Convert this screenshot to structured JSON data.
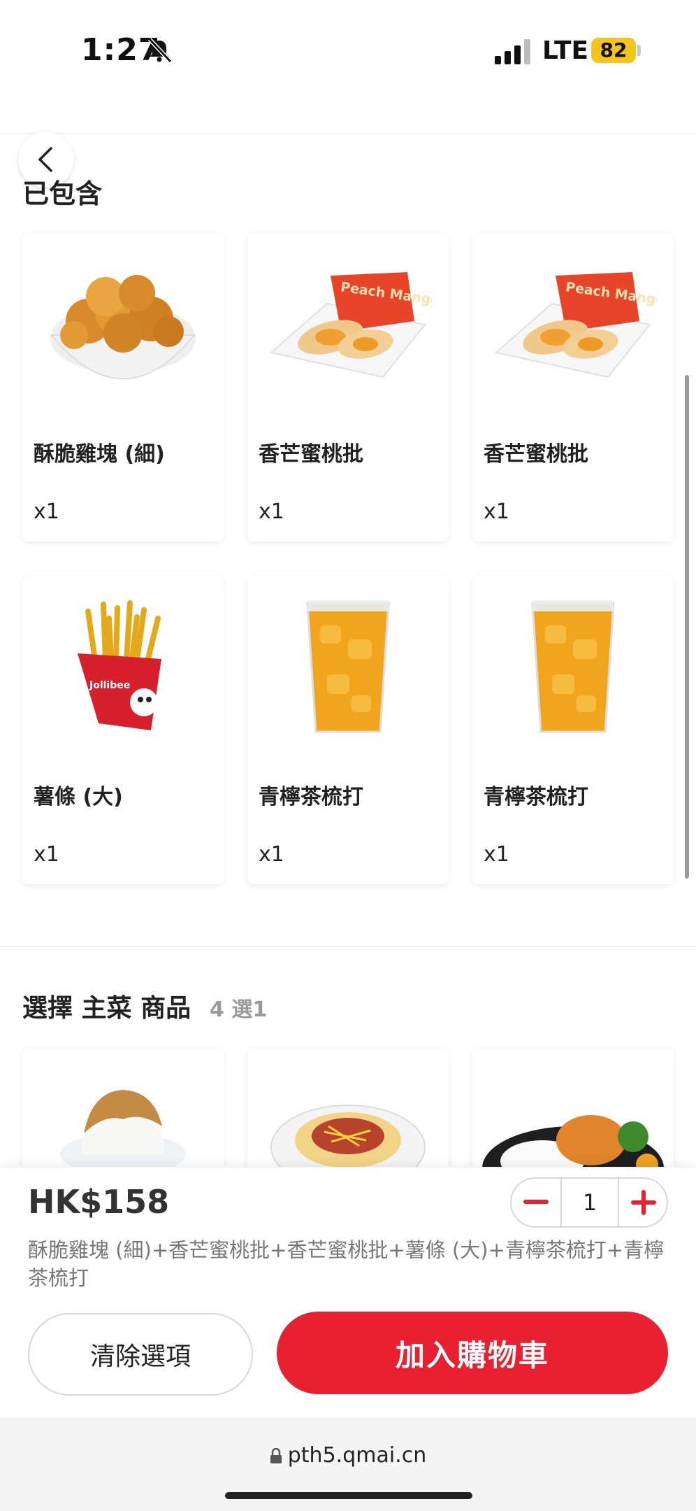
{
  "status_bar": {
    "time": "1:27",
    "network": "LTE",
    "battery": "82"
  },
  "included": {
    "title": "已包含",
    "items": [
      {
        "name": "酥脆雞塊 (細)",
        "qty": "x1",
        "icon": "chicken-nuggets-image"
      },
      {
        "name": "香芒蜜桃批",
        "qty": "x1",
        "icon": "peach-mango-pie-image",
        "package_text": "Peach Mango"
      },
      {
        "name": "香芒蜜桃批",
        "qty": "x1",
        "icon": "peach-mango-pie-image",
        "package_text": "Peach Mango"
      },
      {
        "name": "薯條 (大)",
        "qty": "x1",
        "icon": "fries-image",
        "package_text": "Jollibee"
      },
      {
        "name": "青檸茶梳打",
        "qty": "x1",
        "icon": "iced-lemon-tea-image"
      },
      {
        "name": "青檸茶梳打",
        "qty": "x1",
        "icon": "iced-lemon-tea-image"
      }
    ]
  },
  "choose": {
    "title": "選擇 主菜 商品",
    "count": "4 選1"
  },
  "bottom": {
    "price": "HK$158",
    "quantity": "1",
    "summary": "酥脆雞塊 (細)+香芒蜜桃批+香芒蜜桃批+薯條 (大)+青檸茶梳打+青檸茶梳打",
    "clear_label": "清除選項",
    "add_label": "加入購物車"
  },
  "browser": {
    "url": "pth5.qmai.cn"
  },
  "colors": {
    "accent": "#e8202f",
    "battery": "#f4c51b"
  }
}
